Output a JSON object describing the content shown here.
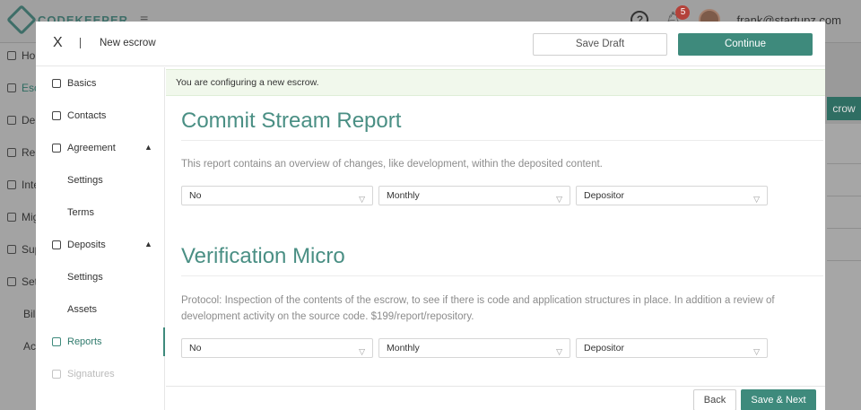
{
  "background": {
    "logo_text": "CODEKEEPER",
    "notification_count": "5",
    "user_email": "frank@startupz.com",
    "sidebar_items": [
      {
        "label": "Home"
      },
      {
        "label": "Escrows"
      },
      {
        "label": "Deposits"
      },
      {
        "label": "Reports"
      },
      {
        "label": "Integrations"
      },
      {
        "label": "Migrations"
      },
      {
        "label": "Support"
      },
      {
        "label": "Settings"
      },
      {
        "label": "Billing"
      },
      {
        "label": "Account"
      }
    ],
    "right_button_label": "crow"
  },
  "modal": {
    "close_label": "X",
    "title": "New escrow",
    "save_draft_label": "Save Draft",
    "continue_label": "Continue",
    "nav": [
      {
        "label": "Basics",
        "icon": "copy-icon"
      },
      {
        "label": "Contacts",
        "icon": "contact-card-icon"
      },
      {
        "label": "Agreement",
        "icon": "document-icon",
        "chevron": "▲"
      },
      {
        "label": "Settings"
      },
      {
        "label": "Terms"
      },
      {
        "label": "Deposits",
        "icon": "database-icon",
        "chevron": "▲"
      },
      {
        "label": "Settings"
      },
      {
        "label": "Assets"
      },
      {
        "label": "Reports",
        "icon": "report-icon",
        "active": true
      },
      {
        "label": "Signatures",
        "icon": "signature-icon",
        "disabled": true
      }
    ],
    "notice": "You are configuring a new escrow.",
    "sections": [
      {
        "title": "Commit Stream Report",
        "description": "This report contains an overview of changes, like development, within the deposited content.",
        "selects": [
          "No",
          "Monthly",
          "Depositor"
        ]
      },
      {
        "title": "Verification Micro",
        "description": "Protocol: Inspection of the contents of the escrow, to see if there is code and application structures in place. In addition a review of development activity on the source code. $199/report/repository.",
        "selects": [
          "No",
          "Monthly",
          "Depositor"
        ]
      }
    ],
    "back_label": "Back",
    "next_label": "Save & Next"
  },
  "colors": {
    "accent": "#3e8a7c",
    "title": "#4a8f84",
    "notice_bg": "#f1f8ec"
  }
}
